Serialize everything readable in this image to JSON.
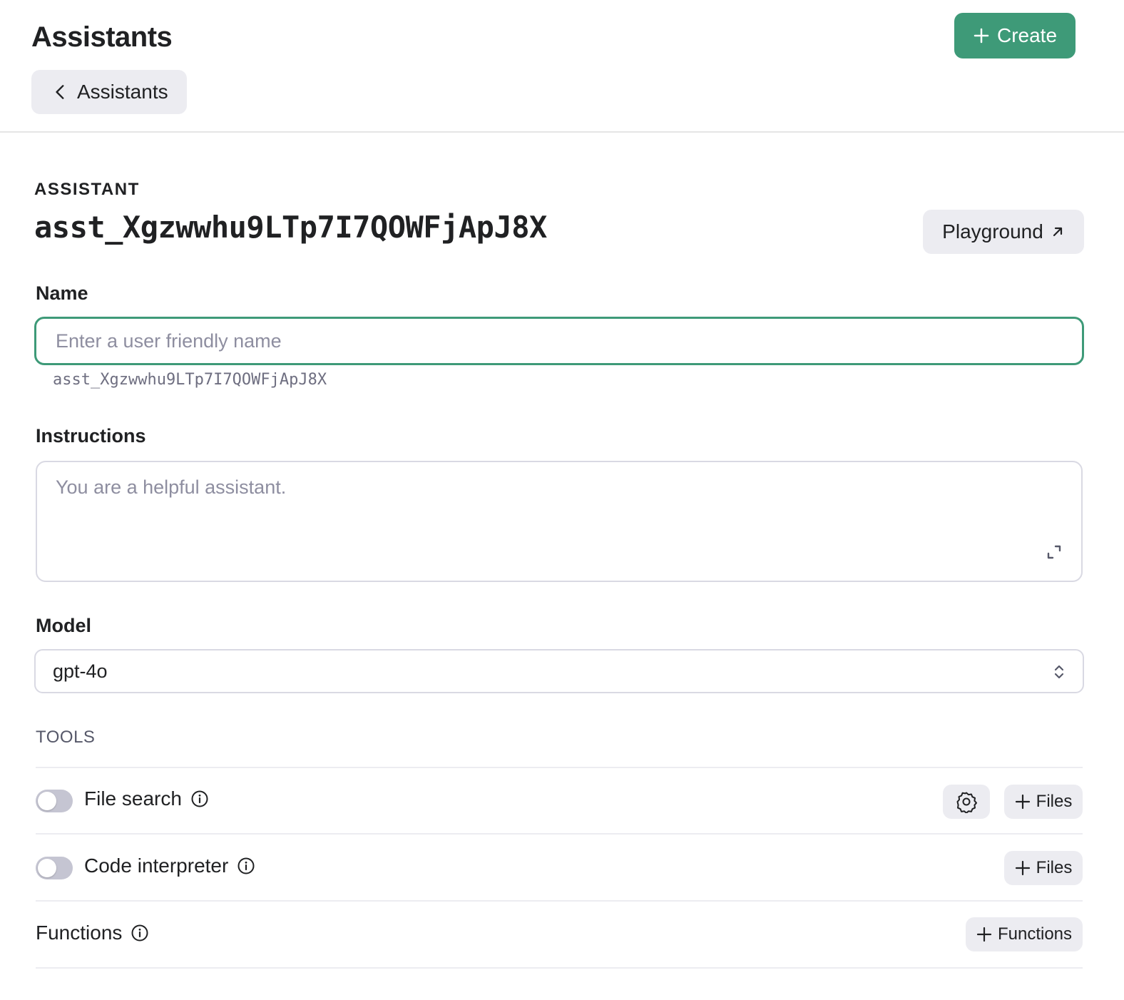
{
  "header": {
    "title": "Assistants",
    "create_label": "Create",
    "back_label": "Assistants"
  },
  "assistant": {
    "section_label": "ASSISTANT",
    "id": "asst_Xgzwwhu9LTp7I7QOWFjApJ8X",
    "playground_label": "Playground"
  },
  "name": {
    "label": "Name",
    "placeholder": "Enter a user friendly name",
    "value": "",
    "hint": "asst_Xgzwwhu9LTp7I7QOWFjApJ8X"
  },
  "instructions": {
    "label": "Instructions",
    "placeholder": "You are a helpful assistant.",
    "value": ""
  },
  "model": {
    "label": "Model",
    "selected": "gpt-4o"
  },
  "tools": {
    "section_label": "TOOLS",
    "file_search": {
      "label": "File search",
      "enabled": false,
      "files_label": "Files"
    },
    "code_interpreter": {
      "label": "Code interpreter",
      "enabled": false,
      "files_label": "Files"
    },
    "functions": {
      "label": "Functions",
      "add_label": "Functions"
    }
  },
  "colors": {
    "accent": "#3e9a78",
    "button_bg": "#ececf1",
    "border": "#d9d9e3",
    "placeholder": "#8e8ea0",
    "toggle_off": "#c5c5d2"
  },
  "icons": [
    "plus-icon",
    "chevron-left-icon",
    "arrow-up-right-icon",
    "expand-icon",
    "chevron-up-down-icon",
    "info-icon",
    "gear-icon"
  ]
}
